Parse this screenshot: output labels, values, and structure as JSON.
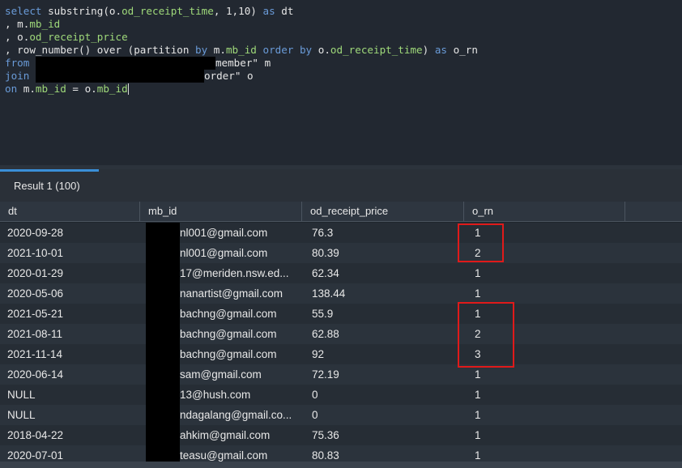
{
  "editor": {
    "line1": {
      "kw1": "select",
      "p1": " substring(o.",
      "f1": "od_receipt_time",
      "p2": ", 1,10) ",
      "kw2": "as",
      "p3": " dt"
    },
    "line2": {
      "p1": ", m.",
      "f1": "mb_id"
    },
    "line3": {
      "p1": ", o.",
      "f1": "od_receipt_price"
    },
    "line4": {
      "p1": ", row_number() over (partition ",
      "kw1": "by",
      "p2": " m.",
      "f1": "mb_id",
      "p3": " ",
      "kw2": "order by",
      "p4": " o.",
      "f2": "od_receipt_time",
      "p5": ") ",
      "kw3": "as",
      "p6": " o_rn"
    },
    "line5": {
      "kw1": "from",
      "tail": "member\" m"
    },
    "line6": {
      "kw1": "join",
      "tail": "order\" o"
    },
    "line7": {
      "kw1": "on",
      "p1": " m.",
      "f1": "mb_id",
      "p2": " = o.",
      "f2": "mb_id"
    }
  },
  "results": {
    "tab_label": "Result 1 (100)",
    "columns": [
      "dt",
      "mb_id",
      "od_receipt_price",
      "o_rn"
    ],
    "rows": [
      [
        "2020-09-28",
        "nl001@gmail.com",
        "76.3",
        "1"
      ],
      [
        "2021-10-01",
        "nl001@gmail.com",
        "80.39",
        "2"
      ],
      [
        "2020-01-29",
        "17@meriden.nsw.ed...",
        "62.34",
        "1"
      ],
      [
        "2020-05-06",
        "nanartist@gmail.com",
        "138.44",
        "1"
      ],
      [
        "2021-05-21",
        "bachng@gmail.com",
        "55.9",
        "1"
      ],
      [
        "2021-08-11",
        "bachng@gmail.com",
        "62.88",
        "2"
      ],
      [
        "2021-11-14",
        "bachng@gmail.com",
        "92",
        "3"
      ],
      [
        "2020-06-14",
        "sam@gmail.com",
        "72.19",
        "1"
      ],
      [
        "NULL",
        "13@hush.com",
        "0",
        "1"
      ],
      [
        "NULL",
        "ndagalang@gmail.co...",
        "0",
        "1"
      ],
      [
        "2018-04-22",
        "ahkim@gmail.com",
        "75.36",
        "1"
      ],
      [
        "2020-07-01",
        "teasu@gmail.com",
        "80.83",
        "1"
      ]
    ]
  },
  "colors": {
    "keyword": "#6a9bd8",
    "field": "#9fd97a",
    "highlight_box": "#e01a1a",
    "tab_accent": "#3a8fd8"
  }
}
